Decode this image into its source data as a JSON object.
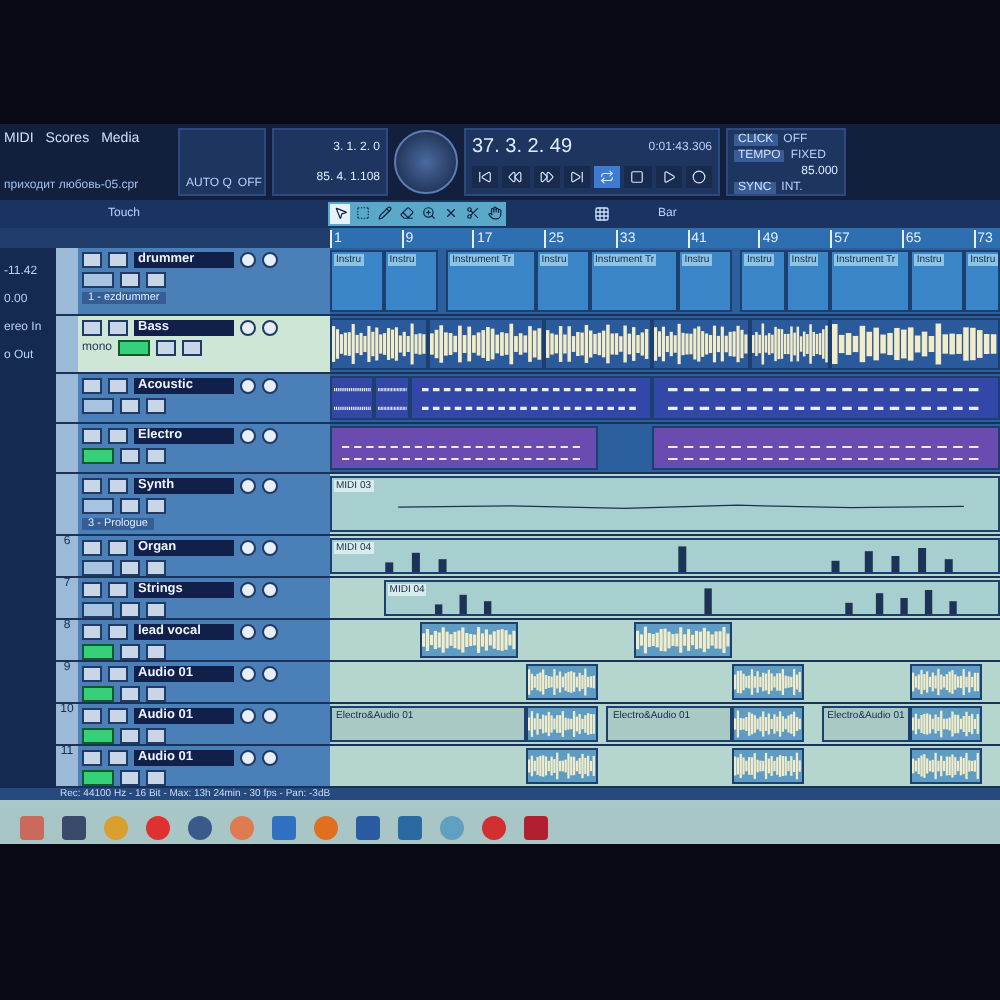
{
  "menu": [
    "MIDI",
    "Scores",
    "Media"
  ],
  "project_title": "приходит любовь-05.cpr",
  "transport": {
    "auto_quantize": {
      "label": "AUTO Q",
      "value": "OFF"
    },
    "left_locator": "3. 1. 2. 0",
    "right_locator": "85. 4. 1.108",
    "position_bars": "37. 3. 2. 49",
    "position_time": "0:01:43.306",
    "click": {
      "label": "CLICK",
      "value": "OFF"
    },
    "tempo": {
      "label": "TEMPO",
      "mode": "FIXED",
      "value": "85.000"
    },
    "sync": {
      "label": "SYNC",
      "value": "INT."
    },
    "cycle_on": true
  },
  "toolbar": {
    "automation_mode": "Touch",
    "grid": "Bar",
    "tools": [
      {
        "kind": "pointer",
        "selected": true
      },
      {
        "kind": "range",
        "selected": false
      },
      {
        "kind": "pencil",
        "selected": false
      },
      {
        "kind": "eraser",
        "selected": false
      },
      {
        "kind": "zoom",
        "selected": false
      },
      {
        "kind": "mute",
        "selected": false
      },
      {
        "kind": "scissors",
        "selected": false
      },
      {
        "kind": "hand",
        "selected": false
      }
    ]
  },
  "inspector": {
    "values": [
      "-11.42",
      "0.00"
    ],
    "routing": [
      "ereo In",
      "o Out"
    ]
  },
  "ruler": [
    "1",
    "9",
    "17",
    "25",
    "33",
    "41",
    "49",
    "57",
    "65",
    "73"
  ],
  "tracks": [
    {
      "name": "drummer",
      "selected": false,
      "monitor": false,
      "instrument": "1 - ezdrummer",
      "events": [
        {
          "kind": "instrument",
          "label": "Instru"
        },
        {
          "kind": "instrument",
          "label": "Instru"
        },
        {
          "kind": "instrument",
          "label": "Instrument Tr"
        },
        {
          "kind": "instrument",
          "label": "Instru"
        },
        {
          "kind": "instrument",
          "label": "Instrument Tr"
        },
        {
          "kind": "instrument",
          "label": "Instru"
        },
        {
          "kind": "instrument",
          "label": "Instru"
        },
        {
          "kind": "instrument",
          "label": "Instru"
        },
        {
          "kind": "instrument",
          "label": "Instrument Tr"
        },
        {
          "kind": "instrument",
          "label": "Instru"
        },
        {
          "kind": "instrument",
          "label": "Instru"
        }
      ]
    },
    {
      "name": "Bass",
      "selected": true,
      "monitor": true,
      "channel": "mono",
      "events": [
        {
          "kind": "audio"
        },
        {
          "kind": "audio"
        },
        {
          "kind": "audio"
        },
        {
          "kind": "audio"
        },
        {
          "kind": "audio"
        },
        {
          "kind": "audio"
        }
      ]
    },
    {
      "name": "Acoustic",
      "selected": false,
      "monitor": false,
      "events": [
        {
          "kind": "midi"
        },
        {
          "kind": "midi"
        },
        {
          "kind": "midi"
        },
        {
          "kind": "midi"
        }
      ]
    },
    {
      "name": "Electro",
      "selected": false,
      "monitor": true,
      "events": [
        {
          "kind": "purple"
        },
        {
          "kind": "purple"
        }
      ]
    },
    {
      "name": "Synth",
      "selected": false,
      "monitor": false,
      "instrument": "3 - Prologue",
      "events": [
        {
          "kind": "line",
          "label": "MIDI 03"
        }
      ]
    },
    {
      "number": "6",
      "name": "Organ",
      "selected": false,
      "monitor": false,
      "events": [
        {
          "kind": "peaks",
          "label": "MIDI 04"
        }
      ]
    },
    {
      "number": "7",
      "name": "Strings",
      "selected": false,
      "monitor": false,
      "events": [
        {
          "kind": "peaks",
          "label": "MIDI 04"
        }
      ]
    },
    {
      "number": "8",
      "name": "lead vocal",
      "selected": false,
      "monitor": true,
      "events": [
        {
          "kind": "audio"
        },
        {
          "kind": "audio"
        }
      ]
    },
    {
      "number": "9",
      "name": "Audio 01",
      "selected": false,
      "monitor": true,
      "events": [
        {
          "kind": "audio"
        },
        {
          "kind": "audio"
        },
        {
          "kind": "audio"
        }
      ]
    },
    {
      "number": "10",
      "name": "Audio 01",
      "selected": false,
      "monitor": true,
      "events": [
        {
          "kind": "region",
          "label": "Electro&Audio 01"
        },
        {
          "kind": "audio"
        },
        {
          "kind": "region",
          "label": "Electro&Audio 01"
        },
        {
          "kind": "audio"
        },
        {
          "kind": "region",
          "label": "Electro&Audio 01"
        },
        {
          "kind": "audio"
        }
      ]
    },
    {
      "number": "11",
      "name": "Audio 01",
      "selected": false,
      "monitor": true,
      "events": [
        {
          "kind": "audio"
        },
        {
          "kind": "audio"
        },
        {
          "kind": "audio"
        }
      ]
    }
  ],
  "status_bar": "Rec: 44100 Hz - 16 Bit - Max: 13h 24min - 30 fps - Pan: -3dB"
}
